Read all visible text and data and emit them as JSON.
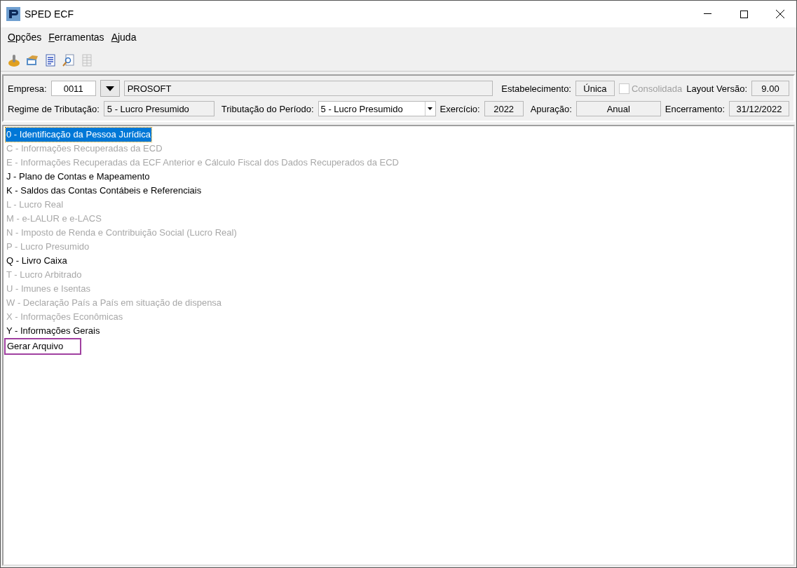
{
  "window": {
    "title": "SPED ECF"
  },
  "menu": [
    {
      "mnemonic": "O",
      "rest": "pções"
    },
    {
      "mnemonic": "F",
      "rest": "erramentas"
    },
    {
      "mnemonic": "A",
      "rest": "juda"
    }
  ],
  "toolbar": [
    {
      "kind": "coin",
      "disabled": false
    },
    {
      "kind": "folder",
      "disabled": false
    },
    {
      "kind": "document",
      "disabled": false
    },
    {
      "kind": "preview",
      "disabled": false
    },
    {
      "kind": "grid",
      "disabled": true
    }
  ],
  "header": {
    "empresa_label": "Empresa:",
    "empresa_code": "0011",
    "empresa_name": "PROSOFT",
    "estabelecimento_label": "Estabelecimento:",
    "estabelecimento": "Única",
    "consolidada": {
      "label": "Consolidada",
      "checked": false,
      "disabled": true
    },
    "layout_label": "Layout Versão:",
    "layout": "9.00",
    "regime_label": "Regime de Tributação:",
    "regime": "5 - Lucro Presumido",
    "periodo_label": "Tributação do Período:",
    "periodo": "5 - Lucro Presumido",
    "exercicio_label": "Exercício:",
    "exercicio": "2022",
    "apuracao_label": "Apuração:",
    "apuracao": "Anual",
    "encerramento_label": "Encerramento:",
    "encerramento": "31/12/2022"
  },
  "blocks": [
    {
      "label": "0 - Identificação da Pessoa Jurídica",
      "disabled": false,
      "selected": true,
      "highlighted": false
    },
    {
      "label": "C - Informações Recuperadas da ECD",
      "disabled": true,
      "selected": false,
      "highlighted": false
    },
    {
      "label": "E - Informações Recuperadas da ECF Anterior e Cálculo Fiscal dos Dados Recuperados da ECD",
      "disabled": true,
      "selected": false,
      "highlighted": false
    },
    {
      "label": "J - Plano de Contas e Mapeamento",
      "disabled": false,
      "selected": false,
      "highlighted": false
    },
    {
      "label": "K - Saldos das Contas Contábeis e Referenciais",
      "disabled": false,
      "selected": false,
      "highlighted": false
    },
    {
      "label": "L - Lucro Real",
      "disabled": true,
      "selected": false,
      "highlighted": false
    },
    {
      "label": "M - e-LALUR e e-LACS",
      "disabled": true,
      "selected": false,
      "highlighted": false
    },
    {
      "label": "N - Imposto de Renda e Contribuição Social (Lucro Real)",
      "disabled": true,
      "selected": false,
      "highlighted": false
    },
    {
      "label": "P - Lucro Presumido",
      "disabled": true,
      "selected": false,
      "highlighted": false
    },
    {
      "label": "Q - Livro Caixa",
      "disabled": false,
      "selected": false,
      "highlighted": false
    },
    {
      "label": "T - Lucro Arbitrado",
      "disabled": true,
      "selected": false,
      "highlighted": false
    },
    {
      "label": "U - Imunes e Isentas",
      "disabled": true,
      "selected": false,
      "highlighted": false
    },
    {
      "label": "W - Declaração País a País em situação de dispensa",
      "disabled": true,
      "selected": false,
      "highlighted": false
    },
    {
      "label": "X - Informações Econômicas",
      "disabled": true,
      "selected": false,
      "highlighted": false
    },
    {
      "label": "Y - Informações Gerais",
      "disabled": false,
      "selected": false,
      "highlighted": false
    },
    {
      "label": "Gerar Arquivo",
      "disabled": false,
      "selected": false,
      "highlighted": true
    }
  ]
}
